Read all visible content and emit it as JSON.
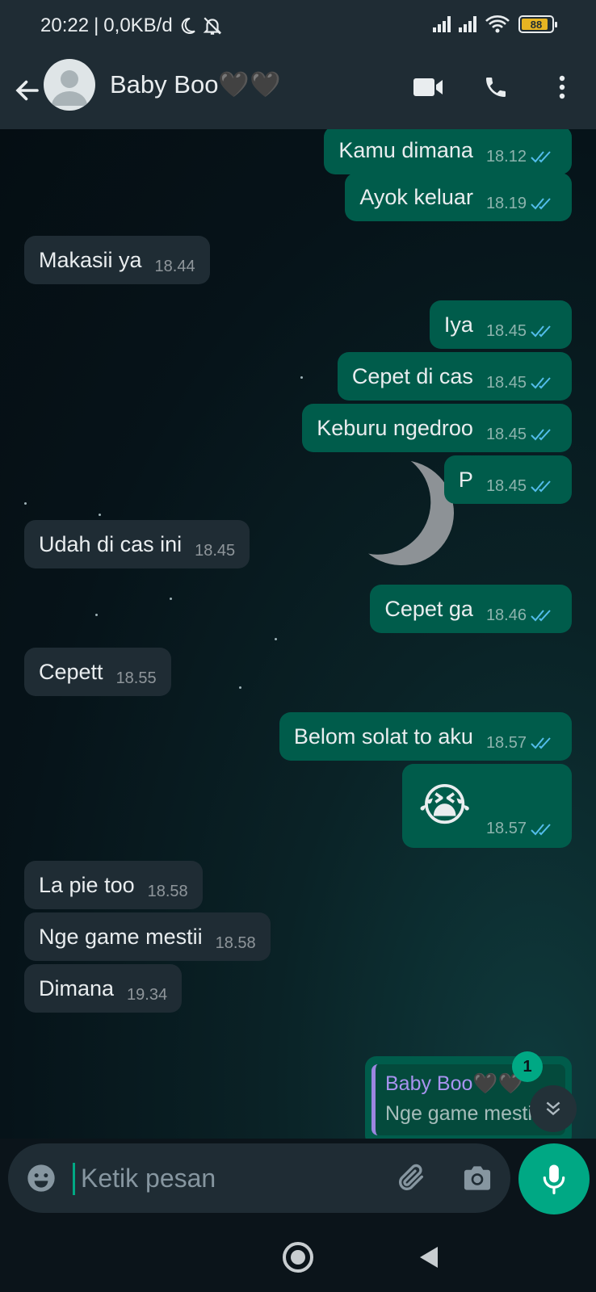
{
  "status_bar": {
    "time": "20:22",
    "separator": "|",
    "data_rate": "0,0KB/d",
    "battery_level": "88",
    "battery_fraction": 0.88
  },
  "header": {
    "contact_name": "Baby Boo🖤🖤",
    "icons": [
      "back-arrow-icon",
      "avatar",
      "video-call-icon",
      "voice-call-icon",
      "more-options-icon"
    ]
  },
  "messages": [
    {
      "dir": "out",
      "text": "Kamu dimana",
      "time": "18.12",
      "read": true
    },
    {
      "dir": "out",
      "text": "Ayok keluar",
      "time": "18.19",
      "read": true
    },
    {
      "dir": "in",
      "text": "Makasii ya",
      "time": "18.44"
    },
    {
      "dir": "out",
      "text": "Iya",
      "time": "18.45",
      "read": true
    },
    {
      "dir": "out",
      "text": "Cepet di cas",
      "time": "18.45",
      "read": true
    },
    {
      "dir": "out",
      "text": "Keburu ngedroo",
      "time": "18.45",
      "read": true
    },
    {
      "dir": "out",
      "text": "P",
      "time": "18.45",
      "read": true
    },
    {
      "dir": "in",
      "text": "Udah di cas ini",
      "time": "18.45"
    },
    {
      "dir": "out",
      "text": "Cepet ga",
      "time": "18.46",
      "read": true
    },
    {
      "dir": "in",
      "text": "Cepett",
      "time": "18.55"
    },
    {
      "dir": "out",
      "text": "Belom solat to aku",
      "time": "18.57",
      "read": true
    },
    {
      "dir": "out",
      "text": "😭",
      "time": "18.57",
      "read": true
    },
    {
      "dir": "in",
      "text": "La pie too",
      "time": "18.58"
    },
    {
      "dir": "in",
      "text": "Nge game mestii",
      "time": "18.58"
    },
    {
      "dir": "in",
      "text": "Dimana",
      "time": "19.34"
    }
  ],
  "reply_preview": {
    "quoted_name": "Baby Boo🖤🖤",
    "quoted_text": "Nge game mestii"
  },
  "unread_count": "1",
  "input": {
    "placeholder": "Ketik pesan",
    "value": ""
  },
  "colors": {
    "outgoing_bubble": "#005c4b",
    "incoming_bubble": "#1f2c34",
    "accent": "#00a884",
    "read_ticks": "#53bdeb"
  }
}
